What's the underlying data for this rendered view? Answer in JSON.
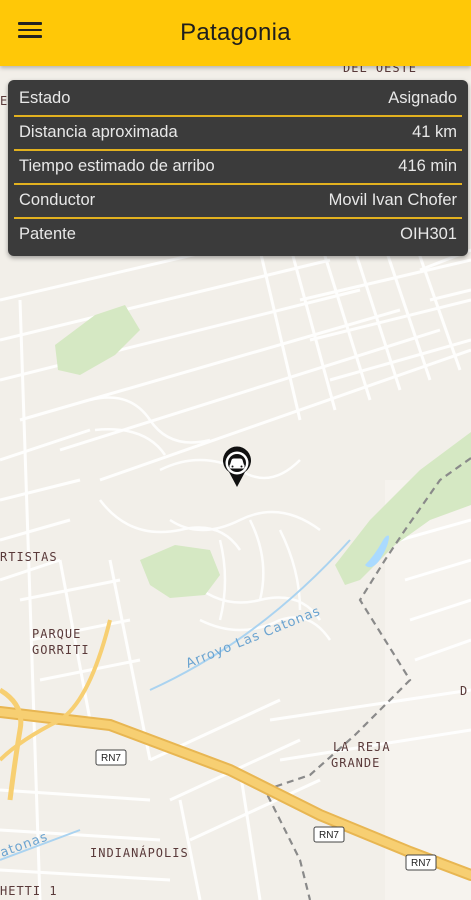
{
  "header": {
    "title": "Patagonia"
  },
  "info": {
    "rows": [
      {
        "label": "Estado",
        "value": "Asignado"
      },
      {
        "label": "Distancia aproximada",
        "value": "41 km"
      },
      {
        "label": "Tiempo estimado de arribo",
        "value": "416 min"
      },
      {
        "label": "Conductor",
        "value": "Movil Ivan Chofer"
      },
      {
        "label": "Patente",
        "value": "OIH301"
      }
    ]
  },
  "map": {
    "labels": {
      "del_oeste": "DEL OESTE",
      "artistas": "RTISTAS",
      "parque": "PARQUE",
      "gorriti": "GORRITI",
      "arroyo": "Arroyo Las Catonas",
      "la_reja": "LA REJA",
      "grande": "GRANDE",
      "indianapolis": "INDIANÁPOLIS",
      "hetti": "HETTI 1",
      "catonas_left": "atonas",
      "edge_d": "D",
      "edge_e": "E"
    },
    "route_shields": [
      "RN7",
      "RN7",
      "RN7"
    ]
  },
  "colors": {
    "appbar": "#ffc807",
    "panel": "#3b3b3b",
    "divider": "#e2b11f",
    "highway": "#f6c86a",
    "park": "#d5e8c3"
  }
}
